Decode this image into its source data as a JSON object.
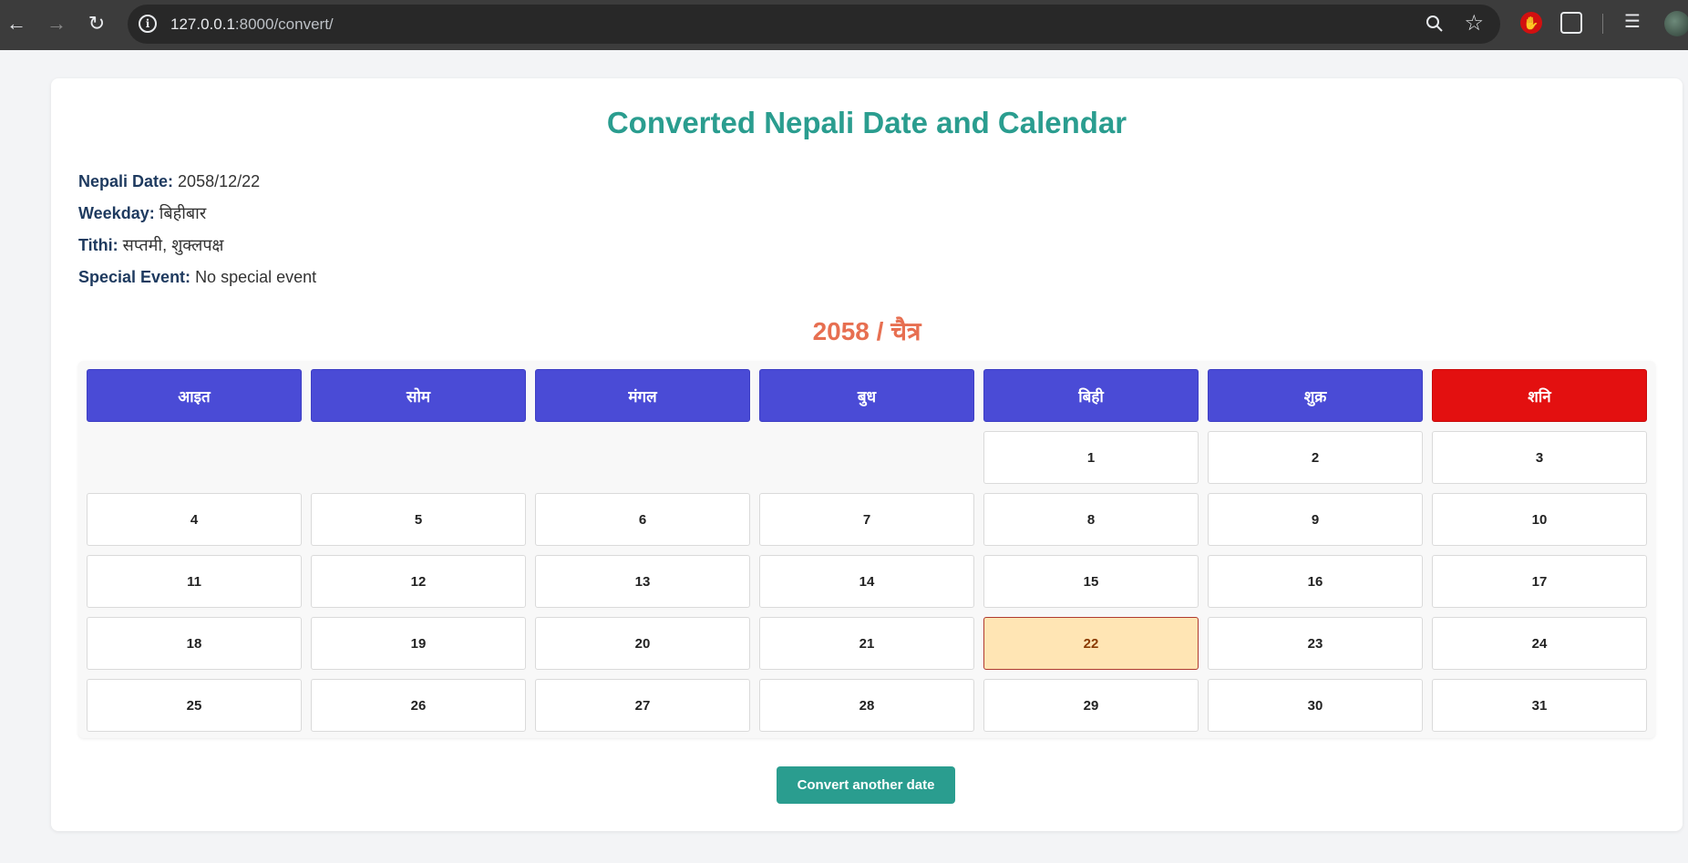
{
  "browser": {
    "url_host": "127.0.0.1",
    "url_rest": ":8000/convert/"
  },
  "page": {
    "title": "Converted Nepali Date and Calendar",
    "info": [
      {
        "label": "Nepali Date:",
        "value": "2058/12/22"
      },
      {
        "label": "Weekday:",
        "value": "बिहीबार"
      },
      {
        "label": "Tithi:",
        "value": "सप्तमी, शुक्लपक्ष"
      },
      {
        "label": "Special Event:",
        "value": "No special event"
      }
    ],
    "month_title": "2058 / चैत्र",
    "weekdays": [
      "आइत",
      "सोम",
      "मंगल",
      "बुध",
      "बिही",
      "शुक्र",
      "शनि"
    ],
    "leading_blanks": 4,
    "days": [
      "1",
      "2",
      "3",
      "4",
      "5",
      "6",
      "7",
      "8",
      "9",
      "10",
      "11",
      "12",
      "13",
      "14",
      "15",
      "16",
      "17",
      "18",
      "19",
      "20",
      "21",
      "22",
      "23",
      "24",
      "25",
      "26",
      "27",
      "28",
      "29",
      "30",
      "31"
    ],
    "selected_day": "22",
    "button_label": "Convert another date"
  },
  "colors": {
    "title": "#2a9d8f",
    "month_title": "#e76f51",
    "weekday_header": "#4a4bd6",
    "saturday_header": "#e31010",
    "selected_cell": "#ffe5b4",
    "button": "#2a9d8f"
  }
}
